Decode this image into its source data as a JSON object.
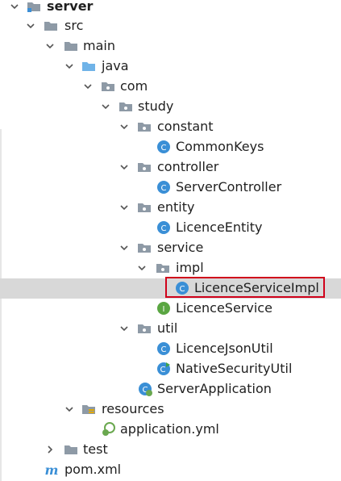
{
  "project_tree": {
    "items": [
      {
        "label": "server",
        "icon": "folder-gray",
        "expander": "expanded",
        "bold": true
      },
      {
        "label": "src",
        "icon": "folder-gray",
        "expander": "expanded"
      },
      {
        "label": "main",
        "icon": "folder-gray",
        "expander": "expanded"
      },
      {
        "label": "java",
        "icon": "folder-blue",
        "expander": "expanded"
      },
      {
        "label": "com",
        "icon": "package",
        "expander": "expanded"
      },
      {
        "label": "study",
        "icon": "package",
        "expander": "expanded"
      },
      {
        "label": "constant",
        "icon": "package",
        "expander": "expanded"
      },
      {
        "label": "CommonKeys",
        "icon": "class",
        "expander": "none"
      },
      {
        "label": "controller",
        "icon": "package",
        "expander": "expanded"
      },
      {
        "label": "ServerController",
        "icon": "class",
        "expander": "none"
      },
      {
        "label": "entity",
        "icon": "package",
        "expander": "expanded"
      },
      {
        "label": "LicenceEntity",
        "icon": "class",
        "expander": "none"
      },
      {
        "label": "service",
        "icon": "package",
        "expander": "expanded"
      },
      {
        "label": "impl",
        "icon": "package",
        "expander": "expanded"
      },
      {
        "label": "LicenceServiceImpl",
        "icon": "class",
        "expander": "none",
        "selected": true
      },
      {
        "label": "LicenceService",
        "icon": "interface",
        "expander": "none"
      },
      {
        "label": "util",
        "icon": "package",
        "expander": "expanded"
      },
      {
        "label": "LicenceJsonUtil",
        "icon": "class",
        "expander": "none"
      },
      {
        "label": "NativeSecurityUtil",
        "icon": "class-runnable",
        "expander": "none"
      },
      {
        "label": "ServerApplication",
        "icon": "spring-boot-class",
        "expander": "none"
      },
      {
        "label": "resources",
        "icon": "folder-resources",
        "expander": "expanded"
      },
      {
        "label": "application.yml",
        "icon": "yml-file",
        "expander": "none"
      },
      {
        "label": "test",
        "icon": "folder-gray",
        "expander": "collapsed"
      },
      {
        "label": "pom.xml",
        "icon": "maven-file",
        "expander": "none"
      }
    ]
  },
  "colors": {
    "class_icon": "#3a8fd6",
    "interface_icon": "#5aa642",
    "folder_gray": "#8e9aa6",
    "folder_blue": "#6fb3e8",
    "selection_bg": "#d8d8d8",
    "highlight_border": "#d0021b"
  }
}
